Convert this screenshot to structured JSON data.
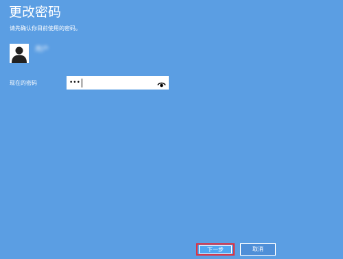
{
  "header": {
    "title": "更改密码",
    "subtitle": "请先确认你目前使用的密码。"
  },
  "user": {
    "name": "用户"
  },
  "form": {
    "current_password_label": "现在的密码",
    "current_password_value": "•••"
  },
  "buttons": {
    "next_label": "下一步",
    "cancel_label": "取消"
  },
  "icons": {
    "avatar": "user-silhouette-icon",
    "reveal": "eye-icon"
  },
  "colors": {
    "background": "#5b9ee3",
    "focus_border": "#e0303e"
  }
}
